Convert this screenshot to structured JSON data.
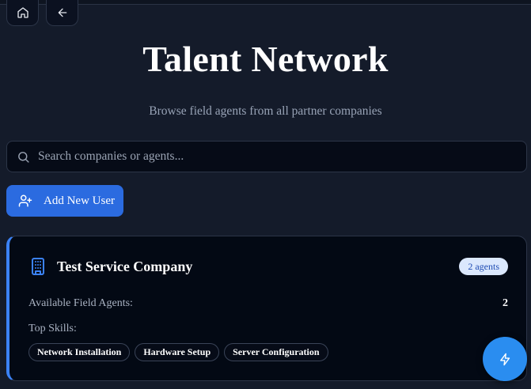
{
  "header": {
    "title": "Talent Network",
    "subtitle": "Browse field agents from all partner companies"
  },
  "search": {
    "placeholder": "Search companies or agents..."
  },
  "actions": {
    "add_user_label": "Add New User"
  },
  "companies": [
    {
      "name": "Test Service Company",
      "agents_badge": "2 agents",
      "available_label": "Available Field Agents:",
      "available_count": "2",
      "skills_label": "Top Skills:",
      "skills": [
        "Network Installation",
        "Hardware Setup",
        "Server Configuration"
      ]
    }
  ],
  "colors": {
    "accent": "#3b82f6",
    "primary_button": "#2b6be0",
    "background": "#141b2a"
  },
  "icons": [
    "home-icon",
    "arrow-left-icon",
    "search-icon",
    "user-plus-icon",
    "building-icon",
    "zap-icon"
  ]
}
